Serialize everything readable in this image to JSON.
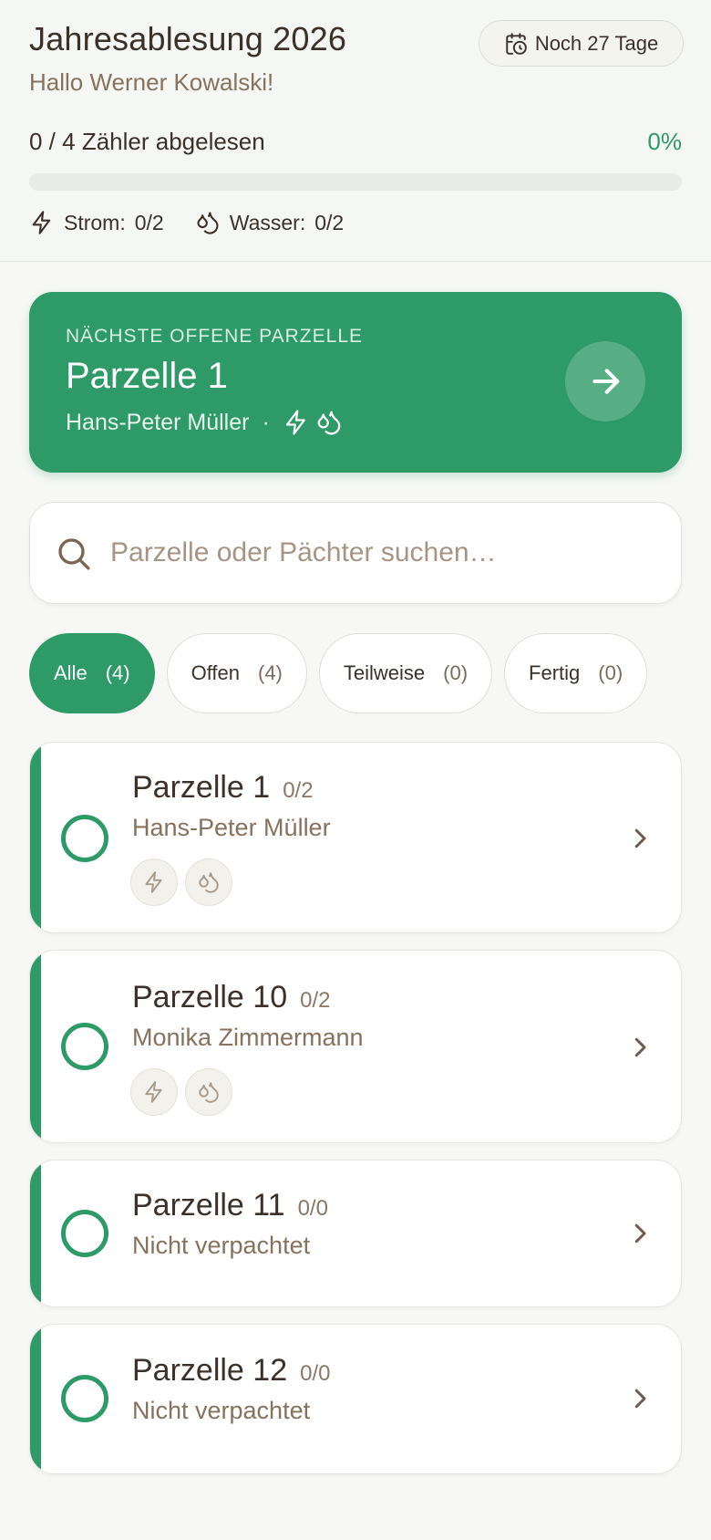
{
  "header": {
    "title": "Jahresablesung 2026",
    "greeting": "Hallo Werner Kowalski!",
    "deadline": "Noch 27 Tage",
    "progress_text": "0 / 4 Zähler abgelesen",
    "progress_percent": "0%",
    "progress_value": 0,
    "stats": {
      "strom_label": "Strom:",
      "strom_value": "0/2",
      "wasser_label": "Wasser:",
      "wasser_value": "0/2"
    }
  },
  "next_card": {
    "label": "NÄCHSTE OFFENE PARZELLE",
    "title": "Parzelle 1",
    "tenant": "Hans-Peter Müller",
    "separator": "·"
  },
  "search": {
    "placeholder": "Parzelle oder Pächter suchen…"
  },
  "filters": [
    {
      "label": "Alle",
      "count": "(4)"
    },
    {
      "label": "Offen",
      "count": "(4)"
    },
    {
      "label": "Teilweise",
      "count": "(0)"
    },
    {
      "label": "Fertig",
      "count": "(0)"
    }
  ],
  "parcels": [
    {
      "name": "Parzelle 1",
      "ratio": "0/2",
      "tenant": "Hans-Peter Müller"
    },
    {
      "name": "Parzelle 10",
      "ratio": "0/2",
      "tenant": "Monika Zimmermann"
    },
    {
      "name": "Parzelle 11",
      "ratio": "0/0",
      "tenant": "Nicht verpachtet"
    },
    {
      "name": "Parzelle 12",
      "ratio": "0/0",
      "tenant": "Nicht verpachtet"
    }
  ],
  "colors": {
    "accent": "#2e9a67",
    "text": "#3b3129",
    "muted": "#86725d"
  }
}
